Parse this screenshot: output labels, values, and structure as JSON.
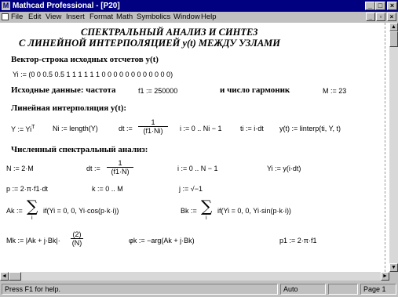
{
  "window": {
    "title": "Mathcad Professional - [P20]",
    "app_icon": "M",
    "minimize": "_",
    "maximize": "□",
    "close": "×",
    "doc_min": "_",
    "doc_restore": "▫",
    "doc_close": "×"
  },
  "menu": [
    "File",
    "Edit",
    "View",
    "Insert",
    "Format",
    "Math",
    "Symbolics",
    "Window",
    "Help"
  ],
  "doc": {
    "heading1": "СПЕКТРАЛЬНЫЙ АНАЛИЗ И СИНТЕЗ",
    "heading2": "С ЛИНЕЙНОЙ ИНТЕРПОЛЯЦИЕЙ y(t) МЕЖДУ УЗЛАМИ",
    "sec_vector": "Вектор-строка исходных отсчетов y(t)",
    "y_def": "Yi := (0  0  0.5  0.5  1  1  1  1  1  1  0  0  0  0  0  0  0  0  0  0  0  0)",
    "sec_input": "Исходные данные: частота",
    "f_def": "f1 := 250000",
    "harm_label": "и число гармоник",
    "m_def": "M := 23",
    "sec_interp": "Линейная интерполяция y(t):",
    "interp_y": "Y := Yi",
    "interp_T": "T",
    "interp_N": "Ni := length(Y)",
    "interp_dt": "dt :=",
    "interp_dt_num": "1",
    "interp_dt_den": "(f1·Ni)",
    "interp_i": "i := 0 .. Ni − 1",
    "interp_ti": "ti := i·dt",
    "interp_yt": "y(t) := linterp(ti, Y, t)",
    "sec_numeric": "Численный спектральный анализ:",
    "n_def": "N := 2·M",
    "dt2": "dt :=",
    "dt2_num": "1",
    "dt2_den": "(f1·N)",
    "i2": "i := 0 .. N − 1",
    "yi": "Yi := y(i·dt)",
    "p_def": "p := 2·π·f1·dt",
    "k_def": "k := 0 .. M",
    "j_def": "j := √−1",
    "a_lhs": "Ak :=",
    "a_sum": "∑",
    "a_idx": "i",
    "a_rhs": "if(Yi = 0, 0, Yi·cos(p·k·i))",
    "b_lhs": "Bk :=",
    "b_sum": "∑",
    "b_idx": "i",
    "b_rhs": "if(Yi = 0, 0, Yi·sin(p·k·i))",
    "mk_lhs": "Mk := |Ak + j·Bk|·",
    "mk_num": "(2)",
    "mk_den": "(N)",
    "phi_def": "φk := −arg(Ak + j·Bk)",
    "p1_def": "p1 := 2·π·f1"
  },
  "status": {
    "help": "Press F1 for help.",
    "mode": "Auto",
    "page": "Page 1"
  }
}
